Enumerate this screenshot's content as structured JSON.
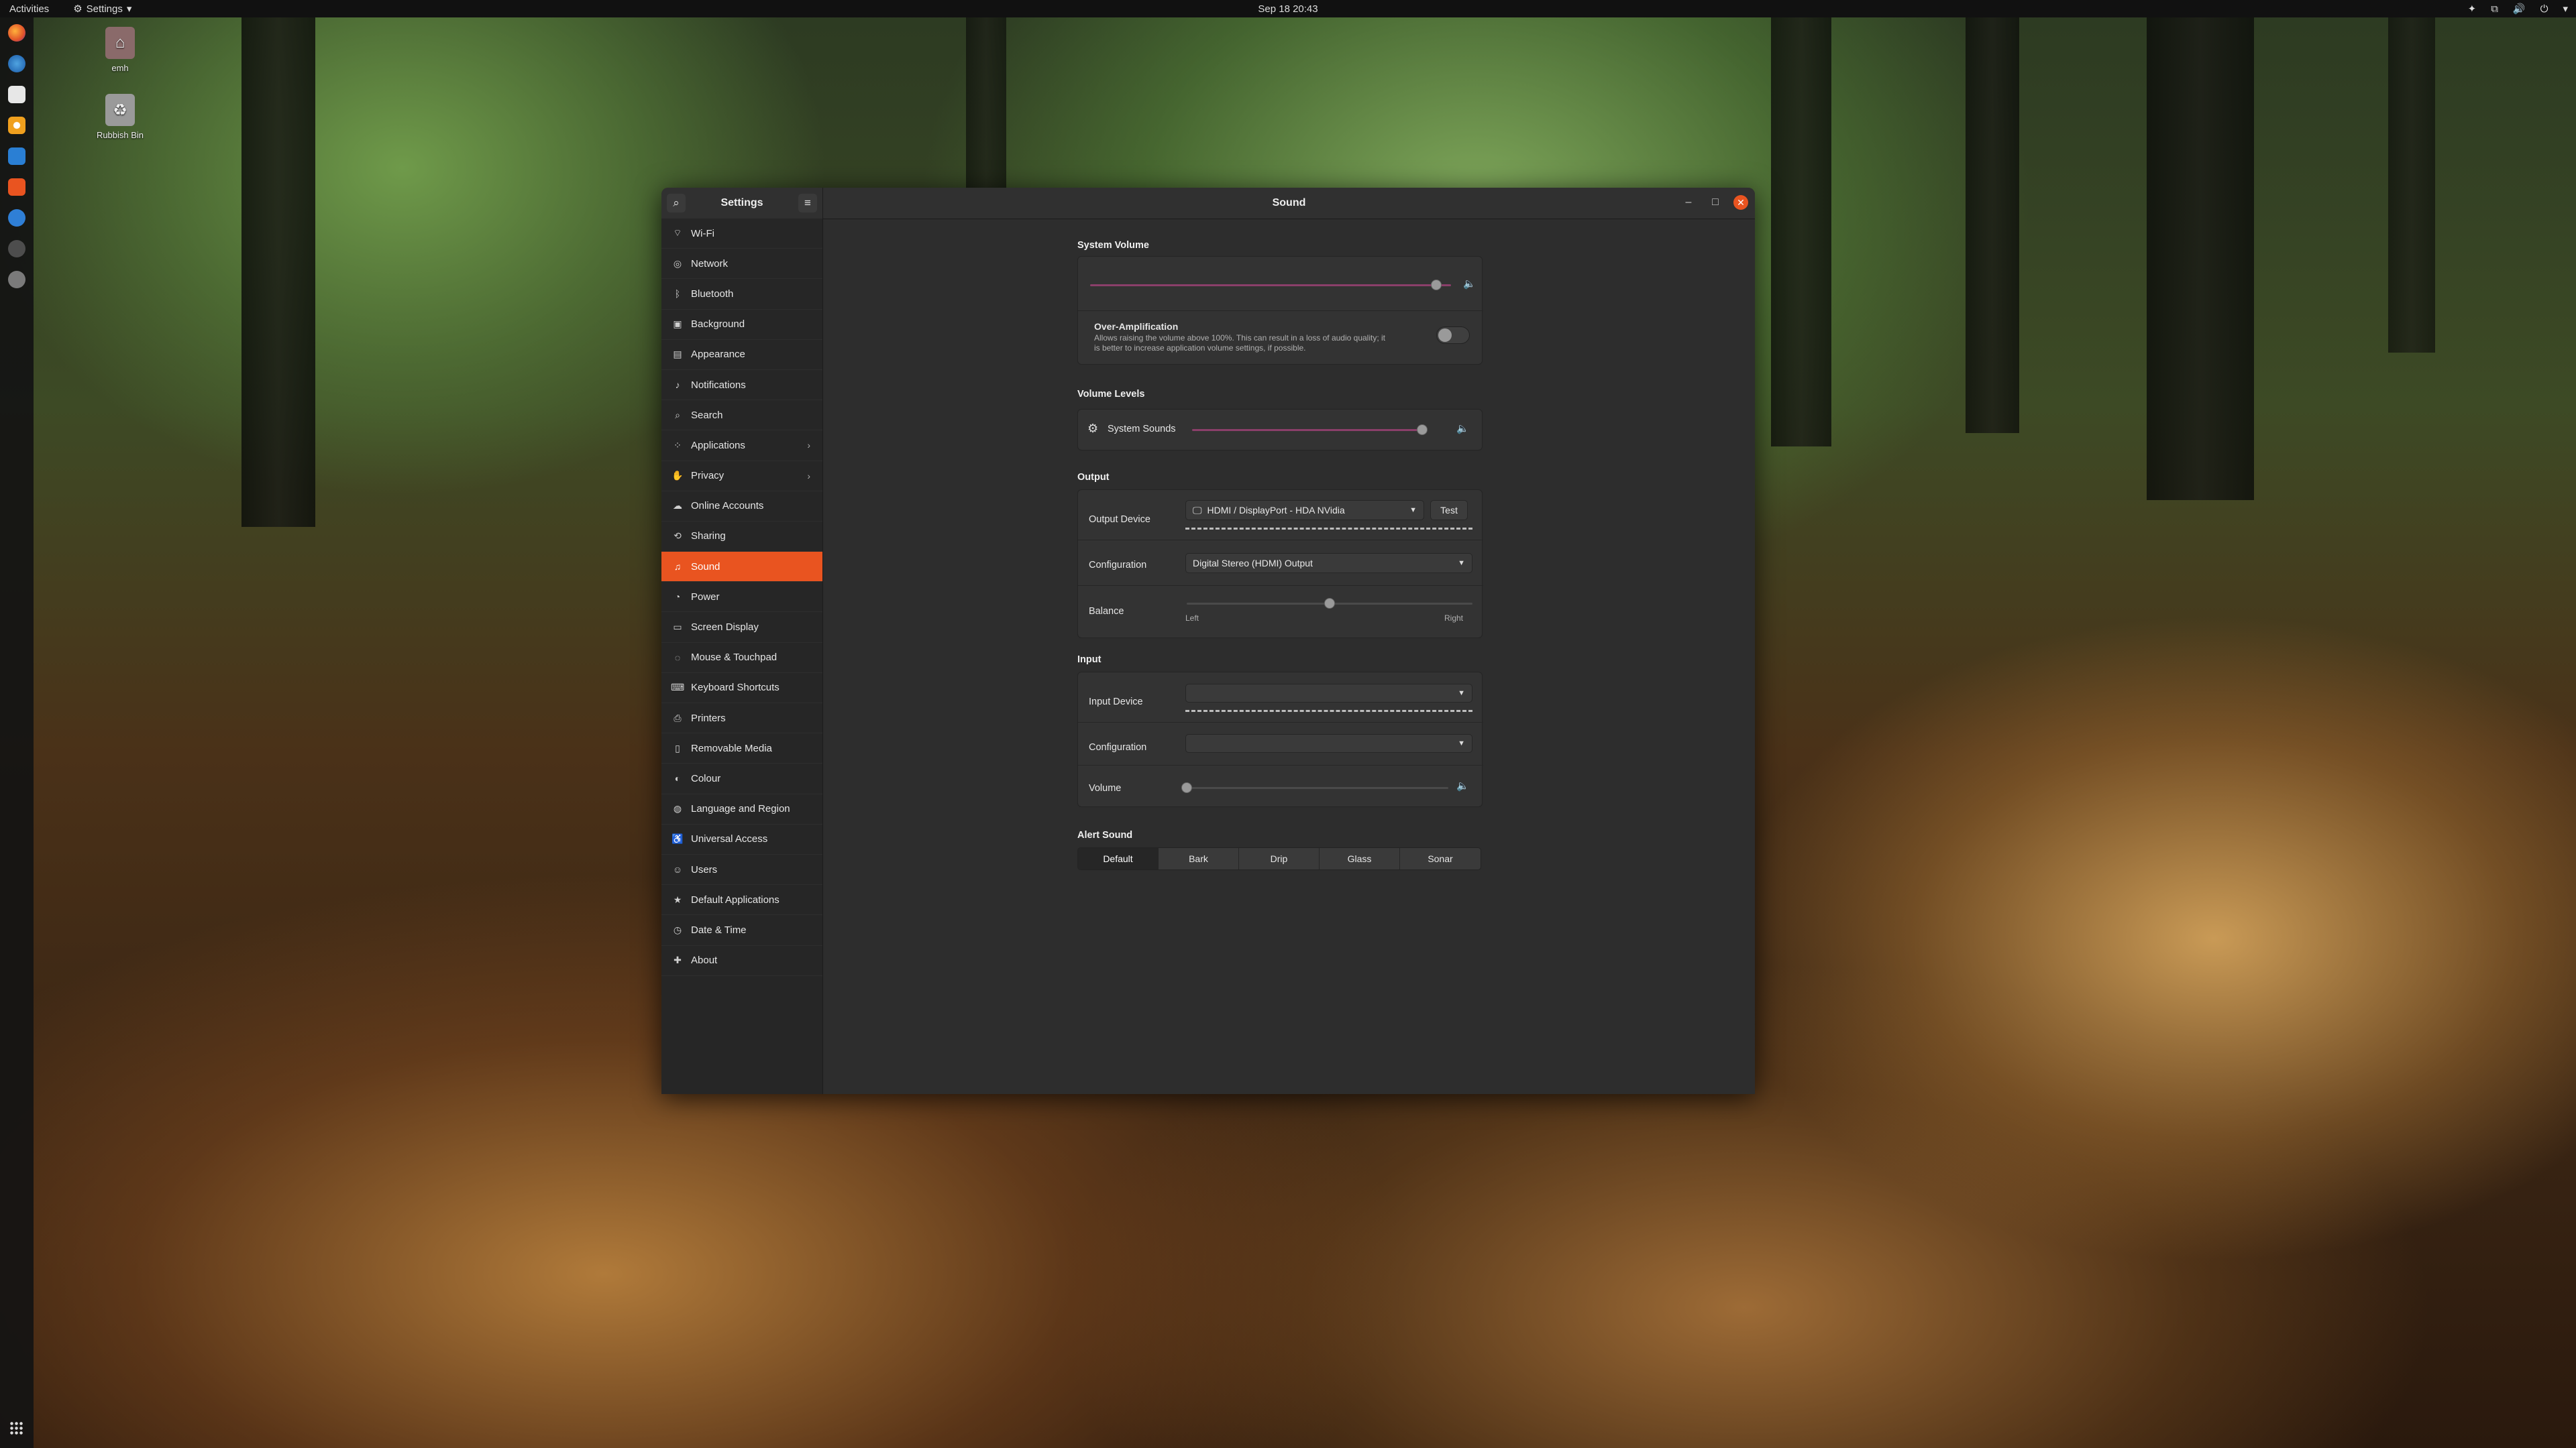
{
  "topbar": {
    "activities": "Activities",
    "app_menu": "Settings",
    "clock": "Sep 18  20:43"
  },
  "desktop": {
    "home_label": "emh",
    "trash_label": "Rubbish Bin"
  },
  "dock": {
    "apps": [
      "firefox",
      "thunderbird",
      "files",
      "rhythmbox",
      "libreoffice-writer",
      "ubuntu-software",
      "help",
      "settings-active",
      "settings"
    ]
  },
  "window": {
    "sidebar_title": "Settings",
    "page_title": "Sound"
  },
  "sidebar": {
    "items": [
      {
        "label": "Wi-Fi",
        "icon": "wifi-icon"
      },
      {
        "label": "Network",
        "icon": "network-icon"
      },
      {
        "label": "Bluetooth",
        "icon": "bluetooth-icon"
      },
      {
        "label": "Background",
        "icon": "background-icon"
      },
      {
        "label": "Appearance",
        "icon": "appearance-icon"
      },
      {
        "label": "Notifications",
        "icon": "bell-icon"
      },
      {
        "label": "Search",
        "icon": "search-icon"
      },
      {
        "label": "Applications",
        "icon": "apps-icon"
      },
      {
        "label": "Privacy",
        "icon": "privacy-icon"
      },
      {
        "label": "Online Accounts",
        "icon": "cloud-icon"
      },
      {
        "label": "Sharing",
        "icon": "share-icon"
      },
      {
        "label": "Sound",
        "icon": "music-icon"
      },
      {
        "label": "Power",
        "icon": "power-icon"
      },
      {
        "label": "Screen Display",
        "icon": "display-icon"
      },
      {
        "label": "Mouse & Touchpad",
        "icon": "mouse-icon"
      },
      {
        "label": "Keyboard Shortcuts",
        "icon": "keyboard-icon"
      },
      {
        "label": "Printers",
        "icon": "printer-icon"
      },
      {
        "label": "Removable Media",
        "icon": "media-icon"
      },
      {
        "label": "Colour",
        "icon": "colour-icon"
      },
      {
        "label": "Language and Region",
        "icon": "globe-icon"
      },
      {
        "label": "Universal Access",
        "icon": "access-icon"
      },
      {
        "label": "Users",
        "icon": "users-icon"
      },
      {
        "label": "Default Applications",
        "icon": "star-icon"
      },
      {
        "label": "Date & Time",
        "icon": "clock-icon"
      },
      {
        "label": "About",
        "icon": "info-icon"
      }
    ],
    "active": "Sound"
  },
  "sound": {
    "system_volume": {
      "title": "System Volume",
      "level": 0.96,
      "over_amp_title": "Over-Amplification",
      "over_amp_desc_1": "Allows raising the volume above 100%. This can result in a loss of audio quality; it",
      "over_amp_desc_2": "is better to increase application volume settings, if possible.",
      "over_amp_enabled": false
    },
    "volume_levels": {
      "title": "Volume Levels",
      "system_sounds_label": "System Sounds",
      "system_sounds_level": 0.98
    },
    "output": {
      "title": "Output",
      "device_label": "Output Device",
      "device_value": "HDMI / DisplayPort - HDA NVidia",
      "test_label": "Test",
      "config_label": "Configuration",
      "config_value": "Digital Stereo (HDMI) Output",
      "balance_label": "Balance",
      "balance_left": "Left",
      "balance_right": "Right",
      "balance_value": 0.5
    },
    "input": {
      "title": "Input",
      "device_label": "Input Device",
      "device_value": "",
      "config_label": "Configuration",
      "config_value": "",
      "volume_label": "Volume",
      "volume_level": 0
    },
    "alert": {
      "title": "Alert Sound",
      "options": [
        "Default",
        "Bark",
        "Drip",
        "Glass",
        "Sonar"
      ],
      "selected": "Default"
    }
  },
  "colors": {
    "accent": "#e95420",
    "slider_fill": "#8b3f6a"
  }
}
